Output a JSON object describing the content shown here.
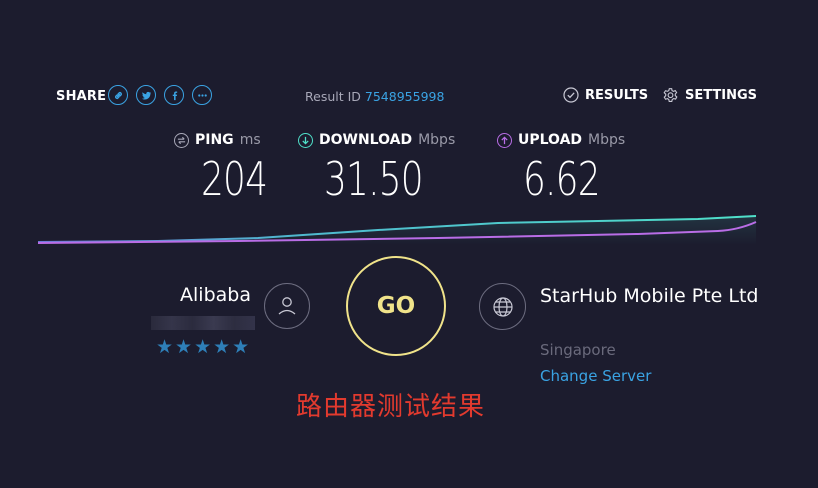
{
  "header": {
    "share_label": "SHARE",
    "share_icons": [
      "link-icon",
      "twitter-icon",
      "facebook-icon",
      "more-icon"
    ],
    "result_label": "Result ID",
    "result_id": "7548955998",
    "results_label": "RESULTS",
    "settings_label": "SETTINGS"
  },
  "metrics": {
    "ping": {
      "name": "PING",
      "unit": "ms",
      "value": "204",
      "icon": "ping-icon",
      "color": "#a8a8b8"
    },
    "download": {
      "name": "DOWNLOAD",
      "unit": "Mbps",
      "value": "31.50",
      "icon": "download-icon",
      "color": "#4fe0c9"
    },
    "upload": {
      "name": "UPLOAD",
      "unit": "Mbps",
      "value": "6.62",
      "icon": "upload-icon",
      "color": "#b96de6"
    }
  },
  "provider": {
    "name": "Alibaba",
    "rating_text": "★★★★★",
    "rating": 5,
    "icon": "user-icon"
  },
  "go_button_label": "GO",
  "server": {
    "name": "StarHub Mobile Pte Ltd",
    "location": "Singapore",
    "change_label": "Change Server",
    "icon": "globe-icon"
  },
  "caption": "路由器测试结果",
  "colors": {
    "background": "#1c1c2e",
    "accent_blue": "#3aa3e3",
    "go_yellow": "#f0e38a",
    "download_line": "#4fe0c9",
    "upload_line": "#b96de6",
    "caption_red": "#e23a2e"
  }
}
